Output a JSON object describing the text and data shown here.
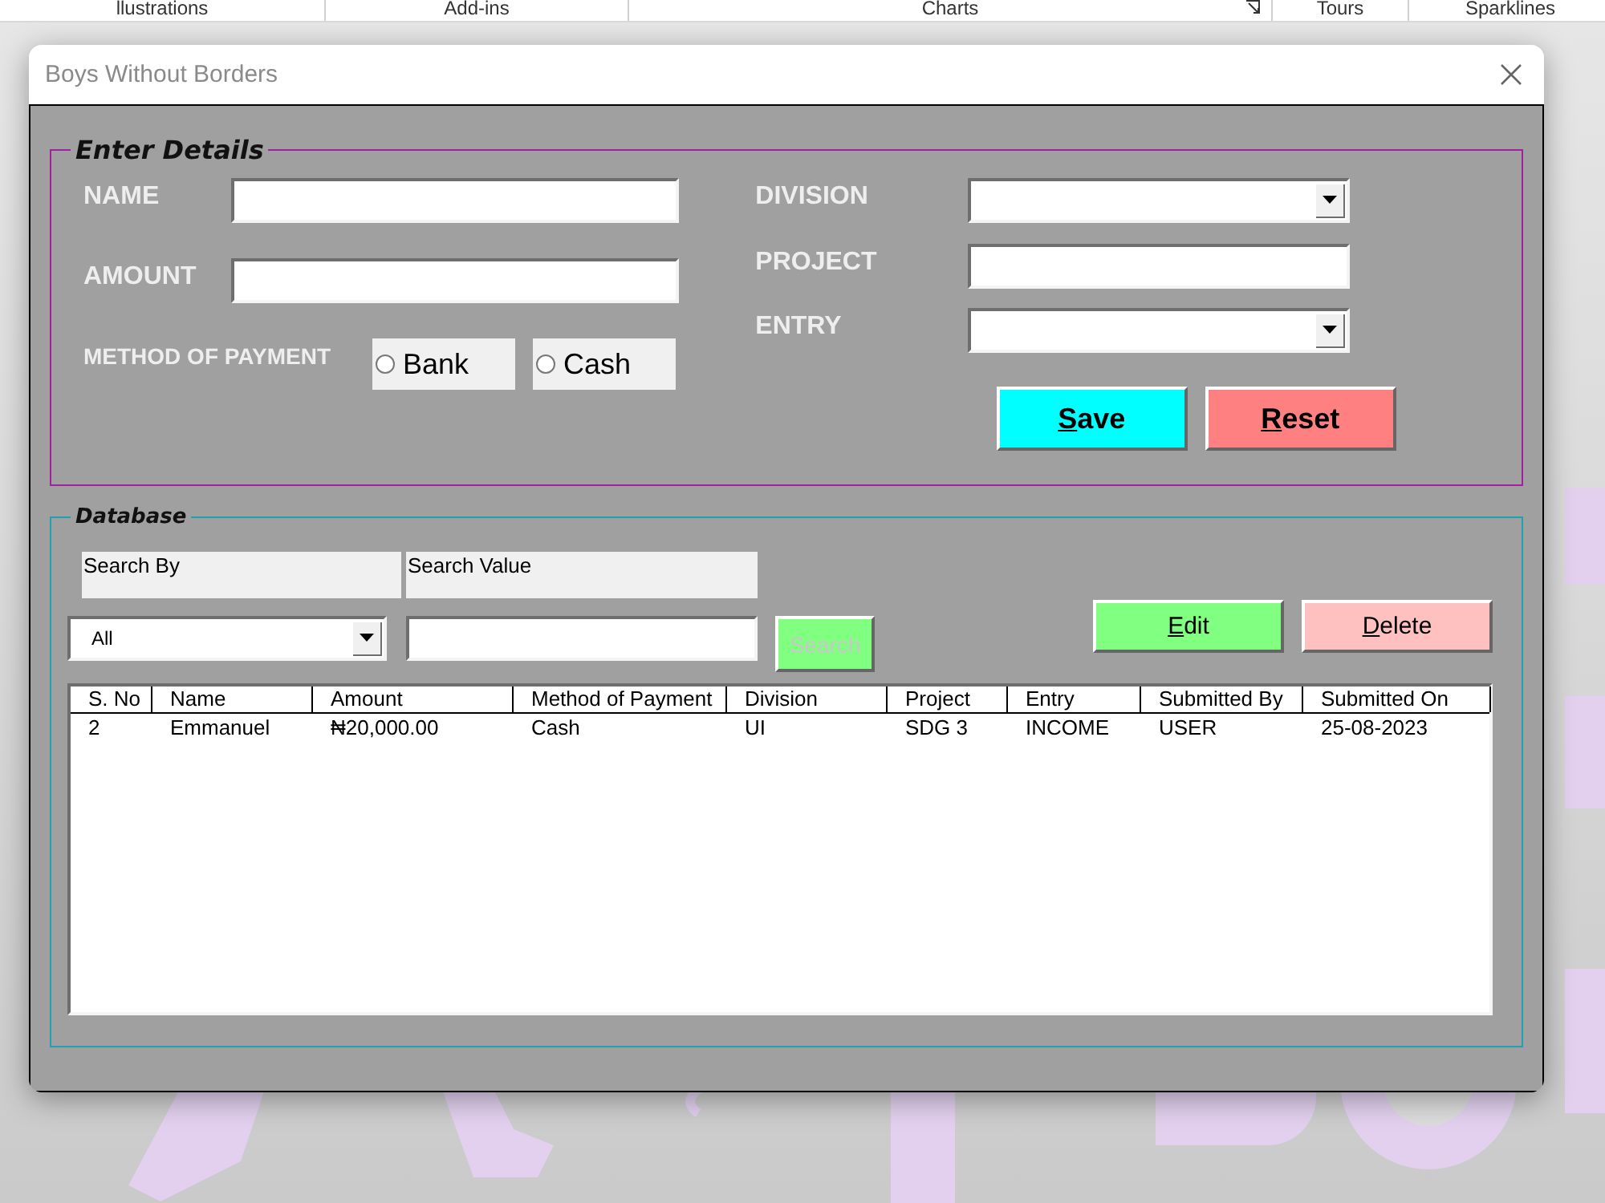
{
  "ribbon_groups": [
    {
      "label": "llustrations",
      "launcher": false
    },
    {
      "label": "Add-ins",
      "launcher": false
    },
    {
      "label": "Charts",
      "launcher": true
    },
    {
      "label": "Tours",
      "launcher": false
    },
    {
      "label": "Sparklines",
      "launcher": false
    }
  ],
  "window": {
    "title": "Boys Without Borders"
  },
  "enter_details": {
    "title": "Enter Details",
    "left_fields": [
      {
        "label": "NAME",
        "kind": "text"
      },
      {
        "label": "AMOUNT",
        "kind": "text"
      }
    ],
    "payment": {
      "label": "METHOD OF PAYMENT",
      "options": [
        {
          "label": "Bank",
          "selected": false
        },
        {
          "label": "Cash",
          "selected": false
        }
      ]
    },
    "right_fields": [
      {
        "label": "DIVISION",
        "kind": "dropdown"
      },
      {
        "label": "PROJECT",
        "kind": "text"
      },
      {
        "label": "ENTRY",
        "kind": "dropdown"
      }
    ],
    "buttons": [
      {
        "label": "Save",
        "color": "#00ffff"
      },
      {
        "label": "Reset",
        "color": "#ff8080"
      }
    ]
  },
  "database": {
    "title": "Database",
    "search_by_label": "Search By",
    "search_value_label": "Search Value",
    "search_by_value": "All",
    "search_button": {
      "label": "Search",
      "disabled": true
    },
    "buttons": [
      {
        "label": "Edit",
        "color": "#80ff80"
      },
      {
        "label": "Delete",
        "color": "#ffc0c0"
      }
    ],
    "table": {
      "columns": [
        "S. No",
        "Name",
        "Amount",
        "Method of Payment",
        "Division",
        "Project",
        "Entry",
        "Submitted By",
        "Submitted On"
      ],
      "rows": [
        [
          "2",
          "Emmanuel",
          "₦20,000.00",
          "Cash",
          "UI",
          "SDG 3",
          "INCOME",
          "USER",
          "25-08-2023"
        ]
      ]
    }
  }
}
